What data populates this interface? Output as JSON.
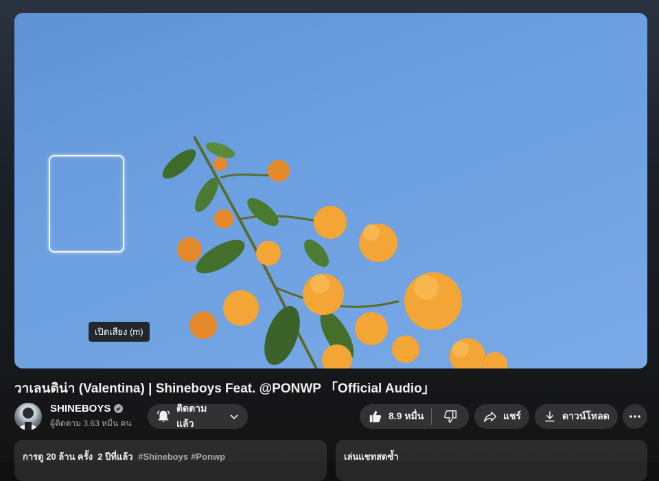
{
  "player": {
    "tooltip": "เปิดเสียง (m)"
  },
  "video": {
    "title": "วาเลนติน่า (Valentina) | Shineboys Feat. @PONWP 「Official Audio」"
  },
  "channel": {
    "name": "SHINEBOYS",
    "subscribers": "ผู้ติดตาม 3.63 หมื่น คน"
  },
  "actions": {
    "subscribe_label": "ติดตามแล้ว",
    "like_count": "8.9 หมื่น",
    "share_label": "แชร์",
    "download_label": "ดาวน์โหลด"
  },
  "description": {
    "meta": "การดู 20 ล้าน ครั้ง  2 ปีที่แล้ว",
    "hashtags": [
      "#Shineboys",
      "#Ponwp"
    ]
  },
  "chat": {
    "label": "เล่นแชทสดซ้ำ"
  },
  "icons": {
    "subscribe": "bell-icon",
    "subscribe_menu": "chevron-down-icon",
    "like": "thumbs-up-icon",
    "dislike": "thumbs-down-icon",
    "share": "share-arrow-icon",
    "download": "download-icon",
    "more": "more-horizontal-icon",
    "verified": "verified-check-icon"
  },
  "colors": {
    "sky": "#6b9fe0",
    "flower": "#f0a030",
    "leaf": "#3f6b2a"
  }
}
